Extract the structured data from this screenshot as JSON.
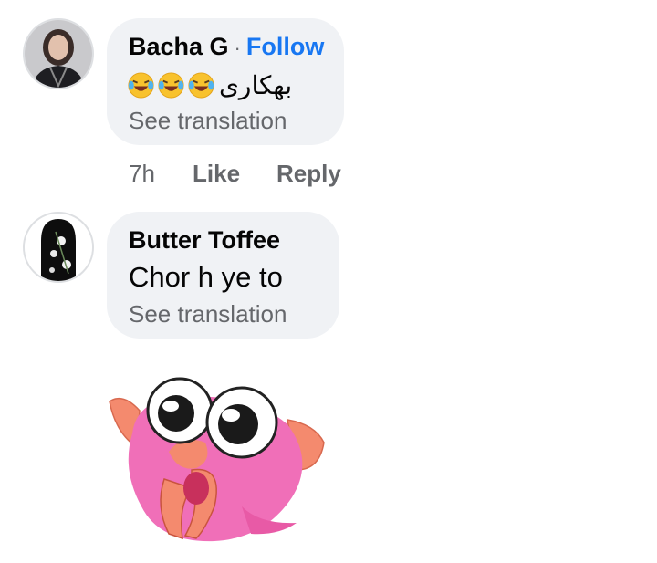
{
  "comments": [
    {
      "author": "Bacha G",
      "separator": "·",
      "follow_label": "Follow",
      "text": "بھکاری",
      "emoji_count": 3,
      "see_translation": "See translation",
      "time": "7h",
      "like_label": "Like",
      "reply_label": "Reply"
    },
    {
      "author": "Butter Toffee",
      "text": "Chor h ye to",
      "see_translation": "See translation"
    }
  ],
  "colors": {
    "bubble": "#f0f2f5",
    "follow": "#1877f2",
    "muted": "#65676b"
  }
}
